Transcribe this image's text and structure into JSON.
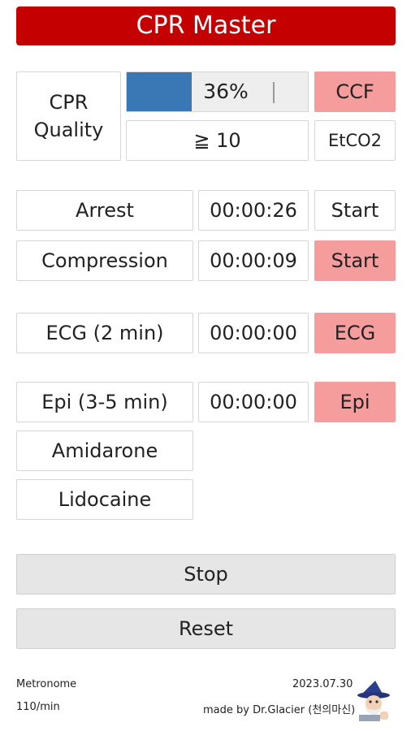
{
  "app": {
    "title": "CPR Master"
  },
  "quality": {
    "label_line1": "CPR",
    "label_line2": "Quality",
    "progress_text": "36%",
    "progress_fraction": 0.36,
    "ccf_label": "CCF",
    "etco2_value": "≧ 10",
    "etco2_label": "EtCO2"
  },
  "timers": [
    {
      "label": "Arrest",
      "time": "00:00:26",
      "button": "Start"
    },
    {
      "label": "Compression",
      "time": "00:00:09",
      "button": "Start"
    },
    {
      "label": "ECG (2 min)",
      "time": "00:00:00",
      "button": "ECG"
    },
    {
      "label": "Epi (3-5 min)",
      "time": "00:00:00",
      "button": "Epi"
    }
  ],
  "drugs": {
    "amidarone": "Amidarone",
    "lidocaine": "Lidocaine"
  },
  "controls": {
    "stop": "Stop",
    "reset": "Reset"
  },
  "footer": {
    "metronome_label": "Metronome",
    "metronome_rate": "110/min",
    "date": "2023.07.30",
    "credit": "made by Dr.Glacier (천의마신)"
  },
  "colors": {
    "header": "#c40000",
    "accent_pink": "#f59c9c",
    "progress_blue": "#3a78b5"
  },
  "icons": {
    "avatar": "wizard-avatar-icon"
  }
}
